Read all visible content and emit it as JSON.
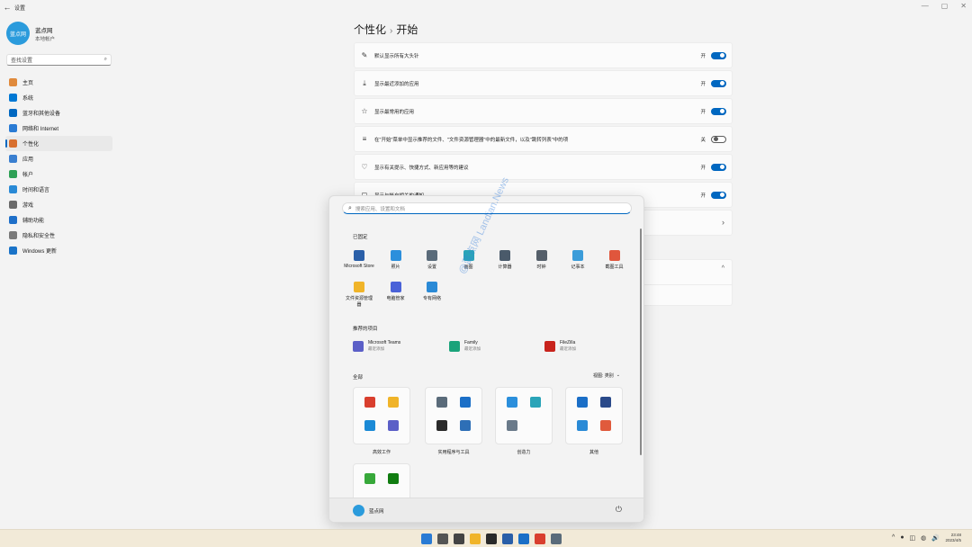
{
  "window": {
    "back_glyph": "←",
    "title": "设置",
    "controls": [
      "—",
      "▢",
      "✕"
    ]
  },
  "profile": {
    "avatar_text": "蓝点网",
    "name": "蓝点网",
    "account_type": "本地帐户"
  },
  "sidebar": {
    "search_placeholder": "查找设置",
    "items": [
      {
        "label": "主页",
        "icon": "home-icon",
        "color": "#e08a3c"
      },
      {
        "label": "系统",
        "icon": "monitor-icon",
        "color": "#0078d4"
      },
      {
        "label": "蓝牙和其他设备",
        "icon": "bluetooth-icon",
        "color": "#0067c0"
      },
      {
        "label": "网络和 Internet",
        "icon": "wifi-icon",
        "color": "#2a7bd4"
      },
      {
        "label": "个性化",
        "icon": "brush-icon",
        "color": "#d86f2e",
        "active": true
      },
      {
        "label": "应用",
        "icon": "apps-icon",
        "color": "#3a7fd0"
      },
      {
        "label": "帐户",
        "icon": "person-icon",
        "color": "#2ea055"
      },
      {
        "label": "时间和语言",
        "icon": "globe-clock-icon",
        "color": "#2a8ad6"
      },
      {
        "label": "游戏",
        "icon": "gamepad-icon",
        "color": "#6a6a6a"
      },
      {
        "label": "辅助功能",
        "icon": "accessibility-icon",
        "color": "#1e6fc9"
      },
      {
        "label": "隐私和安全性",
        "icon": "shield-icon",
        "color": "#7a7a7a"
      },
      {
        "label": "Windows 更新",
        "icon": "update-icon",
        "color": "#1a73c8"
      }
    ]
  },
  "breadcrumb": {
    "parent": "个性化",
    "separator": "›",
    "current": "开始"
  },
  "settings": [
    {
      "icon_glyph": "✎",
      "icon": "pin-icon",
      "label": "默认显示所有大头针",
      "state": "开",
      "on": true
    },
    {
      "icon_glyph": "⤓",
      "icon": "download-icon",
      "label": "显示最近添加的应用",
      "state": "开",
      "on": true
    },
    {
      "icon_glyph": "☆",
      "icon": "star-icon",
      "label": "显示最常用的应用",
      "state": "开",
      "on": true
    },
    {
      "icon_glyph": "≡",
      "icon": "list-icon",
      "label": "在\"开始\"菜单中显示推荐的文件、\"文件资源管理器\"中的最新文件，以及\"跳转列表\"中的项",
      "state": "关",
      "on": false
    },
    {
      "icon_glyph": "♡",
      "icon": "lightbulb-icon",
      "label": "显示有关提示、快捷方式、新应用等的建议",
      "state": "开",
      "on": true
    },
    {
      "icon_glyph": "◻",
      "icon": "notification-icon",
      "label": "显示与帐户相关的通知",
      "state": "开",
      "on": true
    }
  ],
  "extra_row_chevron": "›",
  "extra_panel_chevron": "^",
  "start_menu": {
    "search_placeholder": "搜索应用、设置和文档",
    "pinned_title": "已固定",
    "pinned": [
      {
        "label": "Microsoft Store",
        "color": "#2a5fa8"
      },
      {
        "label": "照片",
        "color": "#2b8fdc"
      },
      {
        "label": "设置",
        "color": "#5a6b7a"
      },
      {
        "label": "画图",
        "color": "#2aa4b8"
      },
      {
        "label": "计算器",
        "color": "#4a5a6a"
      },
      {
        "label": "时钟",
        "color": "#555f6a"
      },
      {
        "label": "记事本",
        "color": "#3b9cd9"
      },
      {
        "label": "截图工具",
        "color": "#e0563c"
      },
      {
        "label": "文件资源管理器",
        "color": "#f0b429"
      },
      {
        "label": "电脑管家",
        "color": "#4a62d8"
      },
      {
        "label": "专有网络",
        "color": "#2a8ad6"
      }
    ],
    "recommended_title": "推荐的项目",
    "recommended": [
      {
        "name": "Microsoft Teams",
        "sub": "最近添加",
        "color": "#5b5fc7"
      },
      {
        "name": "Family",
        "sub": "最近添加",
        "color": "#1aa37a"
      },
      {
        "name": "FileZilla",
        "sub": "最近添加",
        "color": "#c8231c"
      }
    ],
    "all_title": "全部",
    "view_label": "视图: 类别",
    "view_chevron": "⌄",
    "folders": [
      {
        "label": "高效工作",
        "colors": [
          "#d93f2e",
          "#f0b429",
          "#1b8ad6",
          "#5b5fc7"
        ]
      },
      {
        "label": "实用程序与工具",
        "colors": [
          "#5a6b7a",
          "#1b6fc7",
          "#2a2a2a",
          "#2e6fb6"
        ]
      },
      {
        "label": "创造力",
        "colors": [
          "#2b8fdc",
          "#2aa4b8",
          "#6a7a8a",
          "#f3f3f3"
        ]
      },
      {
        "label": "其他",
        "colors": [
          "#1b6fc7",
          "#2a4a8a",
          "#2a8ad6",
          "#e05a3c"
        ]
      },
      {
        "label": "",
        "colors": [
          "#37a83a",
          "#107c10",
          "#f3f3f3",
          "#f3f3f3"
        ]
      }
    ],
    "user_name": "蓝点网"
  },
  "watermark": "@蓝点网 Landian.News",
  "taskbar": {
    "icons": [
      {
        "name": "windows-start",
        "color": "#2a7bd4"
      },
      {
        "name": "search",
        "color": "#555555"
      },
      {
        "name": "task-view",
        "color": "#444444"
      },
      {
        "name": "file-explorer",
        "color": "#f0b429"
      },
      {
        "name": "terminal",
        "color": "#2a2a2a"
      },
      {
        "name": "store",
        "color": "#2a5fa8"
      },
      {
        "name": "remote-desktop",
        "color": "#1b6fc7"
      },
      {
        "name": "chrome",
        "color": "#d93f2e"
      },
      {
        "name": "settings",
        "color": "#5a6b7a"
      }
    ],
    "tray": [
      "^",
      "●",
      "◫",
      "◍",
      "🔊"
    ],
    "time": "23:48",
    "date": "2023/4/5"
  }
}
